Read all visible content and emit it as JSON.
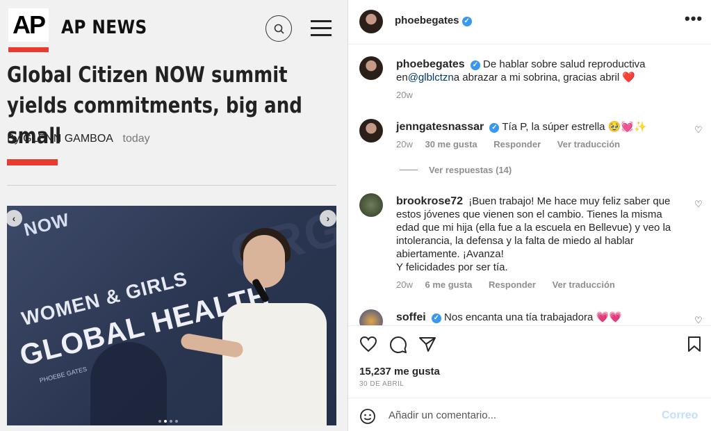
{
  "ap": {
    "logo_text": "AP",
    "brand": "AP NEWS",
    "headline": "Global Citizen NOW summit yields commitments, big and small",
    "byline_prefix": "By",
    "author": "GLENN GAMBOA",
    "date": "today",
    "photo": {
      "sign_line1": "WOMEN & GIRLS",
      "sign_line2": "GLOBAL HEALTH",
      "event_logo": "NOW",
      "nameplate": "PHOEBE GATES",
      "prev_icon": "‹",
      "next_icon": "›",
      "slide_count": 4,
      "current_slide": 2
    }
  },
  "ig": {
    "header_username": "phoebegates",
    "more_icon": "•••",
    "caption": {
      "username": "phoebegates",
      "text_before": "De hablar sobre salud reproductiva en",
      "mention": "@glblctzn",
      "text_after": "a abrazar a mi sobrina, gracias abril ❤️",
      "age": "20w"
    },
    "comments": [
      {
        "username": "jenngatesnassar",
        "verified": true,
        "text": "Tía P, la súper estrella 🥹💓✨",
        "age": "20w",
        "likes": "30 me gusta",
        "reply": "Responder",
        "translate": "Ver traducción",
        "view_replies": "Ver respuestas (14)"
      },
      {
        "username": "brookrose72",
        "verified": false,
        "text": "¡Buen trabajo! Me hace muy feliz saber que estos jóvenes que vienen son el cambio. Tienes la misma edad que mi hija (ella fue a la escuela en Bellevue) y veo la intolerancia, la defensa y la falta de miedo al hablar abiertamente. ¡Avanza!",
        "text_line2": "Y felicidades por ser tía.",
        "age": "20w",
        "likes": "6 me gusta",
        "reply": "Responder",
        "translate": "Ver traducción"
      },
      {
        "username": "soffei",
        "verified": true,
        "text": "Nos encanta una tía trabajadora 💗💗"
      }
    ],
    "likes_count": "15,237 me gusta",
    "post_date": "30 DE ABRIL",
    "comment_placeholder": "Añadir un comentario...",
    "post_button": "Correo"
  },
  "colors": {
    "ap_red": "#e63b2e",
    "verified_blue": "#3897f0",
    "mention_blue": "#00376b",
    "post_button_disabled": "#c0dffd"
  }
}
